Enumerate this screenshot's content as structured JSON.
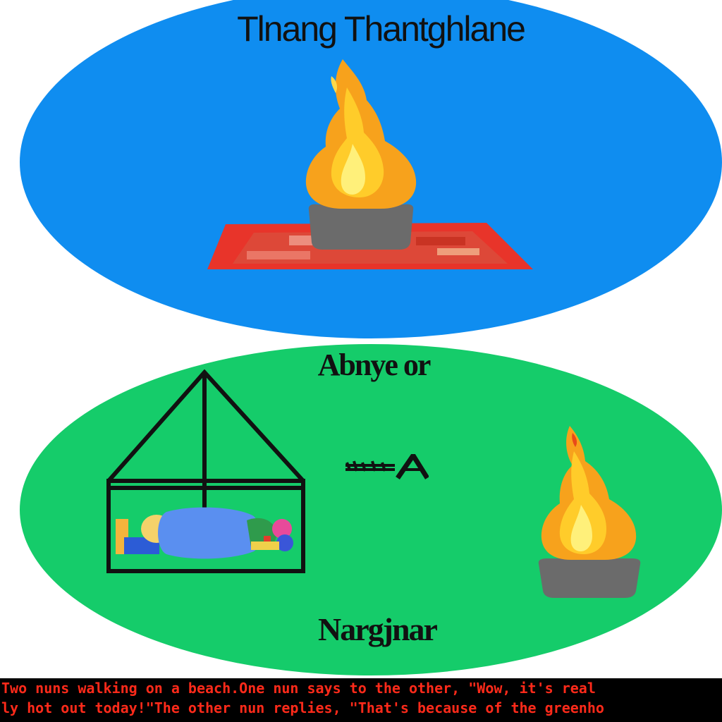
{
  "top_panel": {
    "title": "Tlnang Thantghlane",
    "color": "#0f8df0"
  },
  "bottom_panel": {
    "upper_label": "Abnye or",
    "lower_label": "Nargjnar",
    "color": "#15cc6a"
  },
  "icons": [
    "fire-icon",
    "brazier-icon",
    "rug-icon",
    "tent-icon",
    "sleeping-person-icon",
    "arrow-sign-icon"
  ],
  "caption": {
    "line1": "Two nuns walking on a beach.One nun says to the other, \"Wow, it's real",
    "line2": "ly hot out today!\"The other nun replies, \"That's because of the greenho",
    "text_color": "#ff2a1a",
    "background": "#000000"
  }
}
